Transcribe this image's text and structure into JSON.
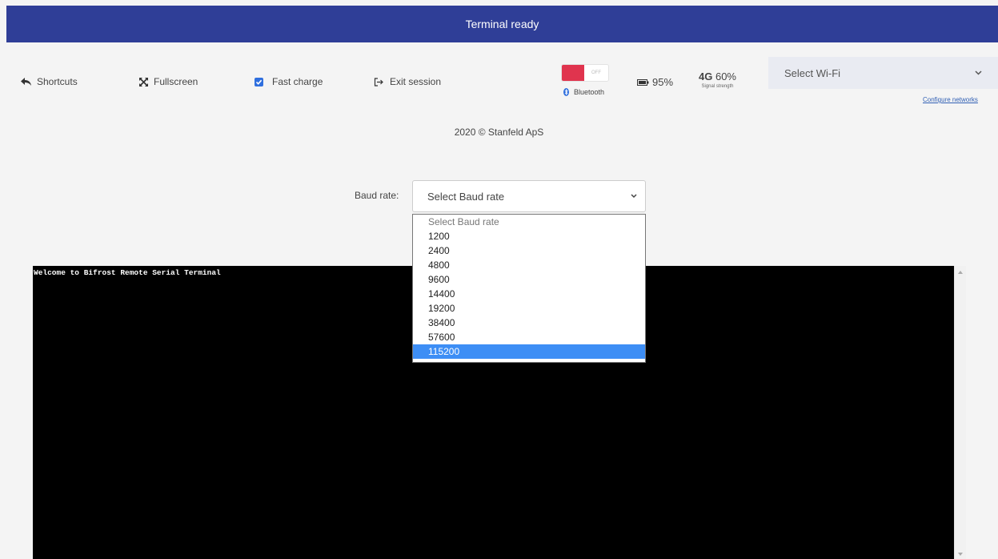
{
  "header": {
    "title": "Terminal ready"
  },
  "toolbar": {
    "shortcuts": "Shortcuts",
    "fullscreen": "Fullscreen",
    "fast_charge": "Fast charge",
    "fast_charge_checked": true,
    "exit_session": "Exit session"
  },
  "status": {
    "bluetooth_toggle": "OFF",
    "bluetooth_label": "Bluetooth",
    "battery": "95%",
    "network_type": "4G",
    "signal_value": "60%",
    "signal_label": "Signal strength",
    "toggle_color": "#e0344e"
  },
  "wifi": {
    "placeholder": "Select Wi-Fi",
    "configure_link": "Configure networks"
  },
  "footer": {
    "copyright": "2020 © Stanfeld ApS"
  },
  "baud": {
    "label": "Baud rate:",
    "selected": "Select Baud rate",
    "options": [
      "Select Baud rate",
      "1200",
      "2400",
      "4800",
      "9600",
      "14400",
      "19200",
      "38400",
      "57600",
      "115200"
    ],
    "highlighted": "115200"
  },
  "terminal": {
    "welcome": "Welcome to Bifrost Remote Serial Terminal"
  },
  "colors": {
    "header_bg": "#2f3e97",
    "accent": "#3d8ef5"
  }
}
